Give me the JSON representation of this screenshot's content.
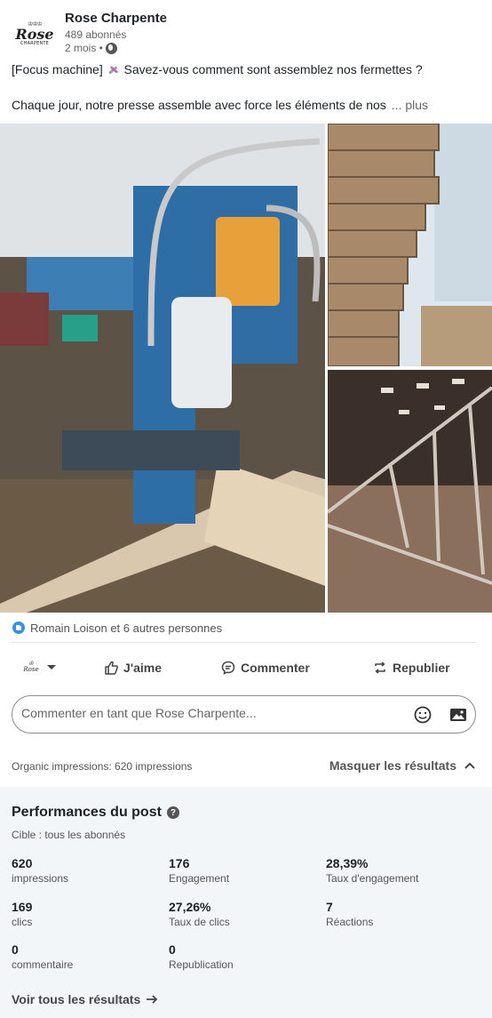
{
  "author": {
    "logo_text": "Rose",
    "logo_subtext": "CHARPENTE",
    "name": "Rose Charpente",
    "followers": "489 abonnés",
    "time": "2 mois •"
  },
  "post": {
    "line1_a": "[Focus machine]",
    "line1_b": "Savez-vous comment sont assemblez nos fermettes ?",
    "line2": "Chaque jour, notre presse assemble avec force les éléments de nos",
    "more": "... plus"
  },
  "reactions": {
    "text": "Romain Loison et 6 autres personnes"
  },
  "actions": {
    "like": "J'aime",
    "comment": "Commenter",
    "repost": "Republier"
  },
  "comment_box": {
    "placeholder": "Commenter en tant que Rose Charpente..."
  },
  "impressions": {
    "organic": "Organic impressions: 620 impressions",
    "hide": "Masquer les résultats"
  },
  "performance": {
    "title": "Performances du post",
    "target": "Cible : tous les abonnés",
    "stats": [
      {
        "value": "620",
        "label": "impressions"
      },
      {
        "value": "176",
        "label": "Engagement"
      },
      {
        "value": "28,39%",
        "label": "Taux d'engagement"
      },
      {
        "value": "169",
        "label": "clics"
      },
      {
        "value": "27,26%",
        "label": "Taux de clics"
      },
      {
        "value": "7",
        "label": "Réactions"
      },
      {
        "value": "0",
        "label": "commentaire"
      },
      {
        "value": "0",
        "label": "Republication"
      }
    ],
    "see_all": "Voir tous les résultats"
  },
  "colors": {
    "accent_blue": "#378fe9",
    "panel_bg": "#f3f6f8"
  }
}
